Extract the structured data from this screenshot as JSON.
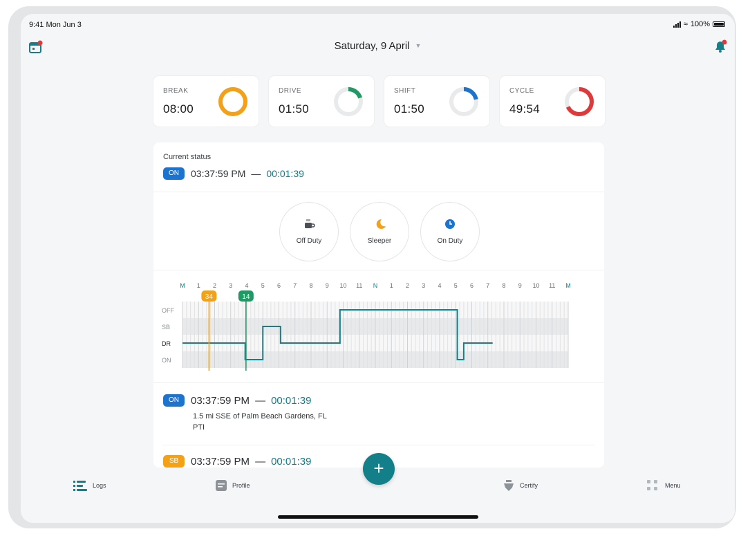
{
  "status_bar": {
    "time": "9:41 Mon Jun 3",
    "battery": "100%"
  },
  "header": {
    "date": "Saturday, 9 April"
  },
  "summary_cards": [
    {
      "label": "BREAK",
      "value": "08:00",
      "progress": 1.0,
      "color": "#f4a11a"
    },
    {
      "label": "DRIVE",
      "value": "01:50",
      "progress": 0.2,
      "color": "#1e9a62"
    },
    {
      "label": "SHIFT",
      "value": "01:50",
      "progress": 0.22,
      "color": "#1d74cf"
    },
    {
      "label": "CYCLE",
      "value": "49:54",
      "progress": 0.68,
      "color": "#e0393a"
    }
  ],
  "current_status": {
    "label": "Current status",
    "badge": "ON",
    "time": "03:37:59 PM",
    "separator": "—",
    "duration": "00:01:39"
  },
  "duty_buttons": [
    {
      "label": "Off Duty",
      "icon": "coffee-icon"
    },
    {
      "label": "Sleeper",
      "icon": "moon-icon"
    },
    {
      "label": "On Duty",
      "icon": "clock-icon"
    }
  ],
  "log_graph": {
    "hour_labels": [
      "M",
      "1",
      "2",
      "3",
      "4",
      "5",
      "6",
      "7",
      "8",
      "9",
      "10",
      "11",
      "N",
      "1",
      "2",
      "3",
      "4",
      "5",
      "6",
      "7",
      "8",
      "9",
      "10",
      "11",
      "M"
    ],
    "row_labels": [
      "OFF",
      "SB",
      "DR",
      "ON"
    ],
    "markers": [
      {
        "label": "34",
        "hour": 1.65,
        "color": "#f4a11a"
      },
      {
        "label": "14",
        "hour": 3.95,
        "color": "#1e9a62"
      }
    ]
  },
  "log_entries": [
    {
      "badge": "ON",
      "time": "03:37:59 PM",
      "separator": "—",
      "duration": "00:01:39",
      "location": "1.5 mi SSE of Palm Beach Gardens, FL",
      "note": "PTI"
    },
    {
      "badge": "SB",
      "time": "03:37:59 PM",
      "separator": "—",
      "duration": "00:01:39"
    }
  ],
  "tab_bar": {
    "logs": "Logs",
    "profile": "Profile",
    "certify": "Certify",
    "menu": "Menu"
  },
  "colors": {
    "accent": "#137f89",
    "on": "#1d74cf",
    "sb": "#f4a11a",
    "drive": "#1e9a62",
    "cycle": "#e0393a"
  }
}
